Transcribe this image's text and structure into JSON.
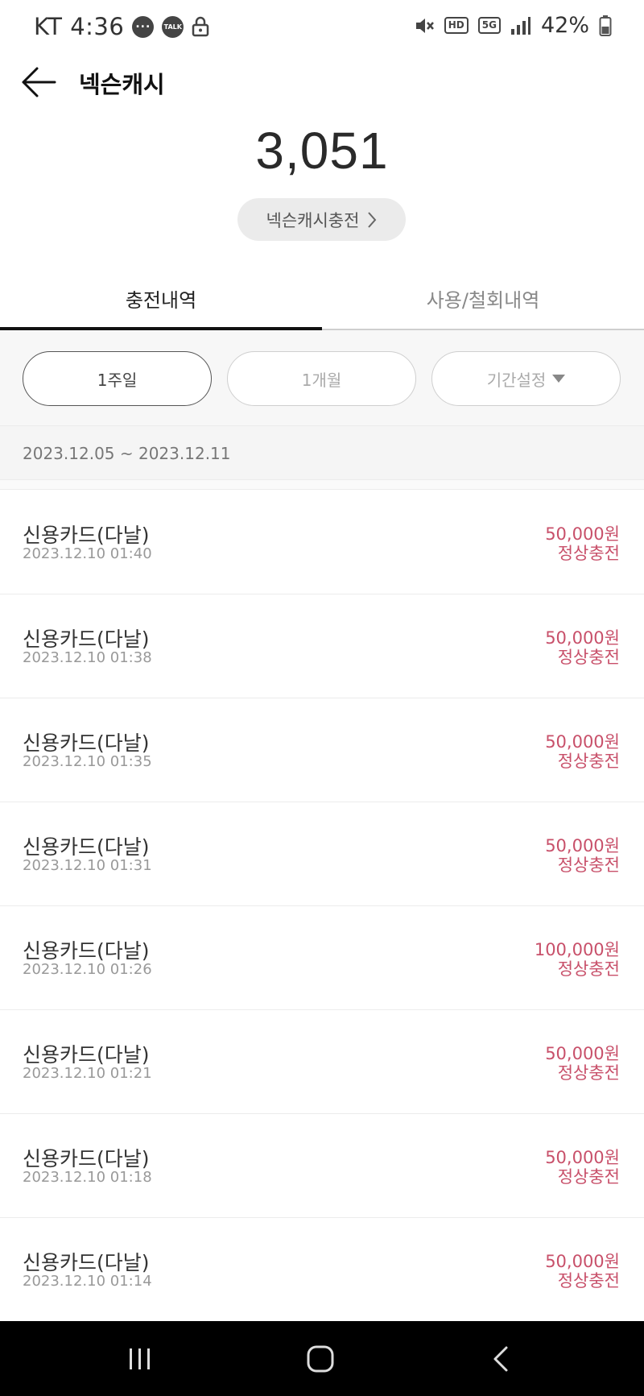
{
  "status_bar": {
    "carrier_time": "KT 4:36",
    "talk_label": "TALK",
    "hd_label": "HD",
    "network_label": "5G",
    "battery": "42%"
  },
  "header": {
    "title": "넥슨캐시"
  },
  "balance": {
    "amount": "3,051",
    "charge_button_label": "넥슨캐시충전"
  },
  "tabs": [
    {
      "label": "충전내역",
      "active": true
    },
    {
      "label": "사용/철회내역",
      "active": false
    }
  ],
  "filters": [
    {
      "label": "1주일",
      "selected": true
    },
    {
      "label": "1개월",
      "selected": false
    },
    {
      "label": "기간설정",
      "selected": false
    }
  ],
  "date_range": "2023.12.05 ~ 2023.12.11",
  "transactions": [
    {
      "method": "신용카드(다날)",
      "datetime": "2023.12.10 01:40",
      "amount": "50,000원",
      "status": "정상충전"
    },
    {
      "method": "신용카드(다날)",
      "datetime": "2023.12.10 01:38",
      "amount": "50,000원",
      "status": "정상충전"
    },
    {
      "method": "신용카드(다날)",
      "datetime": "2023.12.10 01:35",
      "amount": "50,000원",
      "status": "정상충전"
    },
    {
      "method": "신용카드(다날)",
      "datetime": "2023.12.10 01:31",
      "amount": "50,000원",
      "status": "정상충전"
    },
    {
      "method": "신용카드(다날)",
      "datetime": "2023.12.10 01:26",
      "amount": "100,000원",
      "status": "정상충전"
    },
    {
      "method": "신용카드(다날)",
      "datetime": "2023.12.10 01:21",
      "amount": "50,000원",
      "status": "정상충전"
    },
    {
      "method": "신용카드(다날)",
      "datetime": "2023.12.10 01:18",
      "amount": "50,000원",
      "status": "정상충전"
    },
    {
      "method": "신용카드(다날)",
      "datetime": "2023.12.10 01:14",
      "amount": "50,000원",
      "status": "정상충전"
    }
  ],
  "colors": {
    "accent_amount": "#c8506a",
    "active_tab_bar": "#111111",
    "nav_bar": "#000000"
  },
  "icons": {
    "back": "arrow-left-icon",
    "chevron": "chevron-right-icon",
    "dropdown": "caret-down-icon",
    "nav_recents": "recents-icon",
    "nav_home": "home-icon",
    "nav_back": "nav-back-icon"
  }
}
